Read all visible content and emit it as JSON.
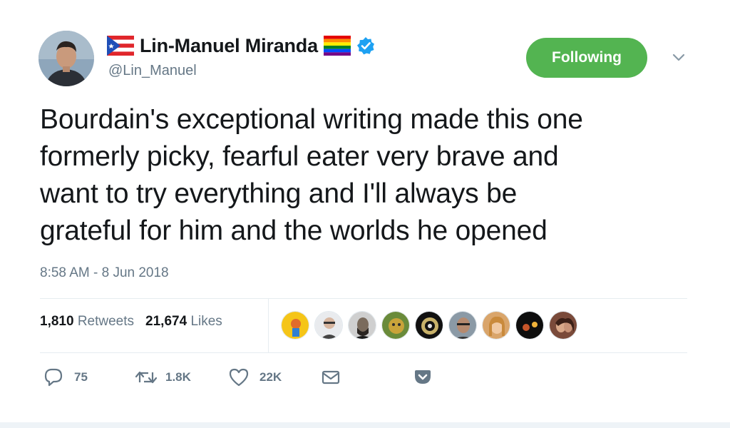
{
  "user": {
    "name": "Lin-Manuel Miranda",
    "handle": "@Lin_Manuel",
    "verified": true,
    "flag_left": "puerto-rico-flag",
    "flag_right": "rainbow-flag"
  },
  "follow_button": {
    "label": "Following",
    "color": "#53b451"
  },
  "tweet": {
    "text_lines": [
      "Bourdain's exceptional writing made this one",
      "formerly picky, fearful eater very brave and",
      "want to try everything and I'll always be",
      "grateful for him and the worlds he opened"
    ],
    "timestamp": "8:58 AM - 8 Jun 2018"
  },
  "stats": {
    "retweets_count": "1,810",
    "retweets_label": "Retweets",
    "likes_count": "21,674",
    "likes_label": "Likes"
  },
  "liker_avatars": [
    "avatar-1",
    "avatar-2",
    "avatar-3",
    "avatar-4",
    "avatar-5",
    "avatar-6",
    "avatar-7",
    "avatar-8",
    "avatar-9"
  ],
  "actions": {
    "reply_count": "75",
    "retweet_count": "1.8K",
    "like_count": "22K"
  },
  "colors": {
    "accent": "#1da1f2",
    "secondary_text": "#657786",
    "follow_green": "#53b451"
  }
}
